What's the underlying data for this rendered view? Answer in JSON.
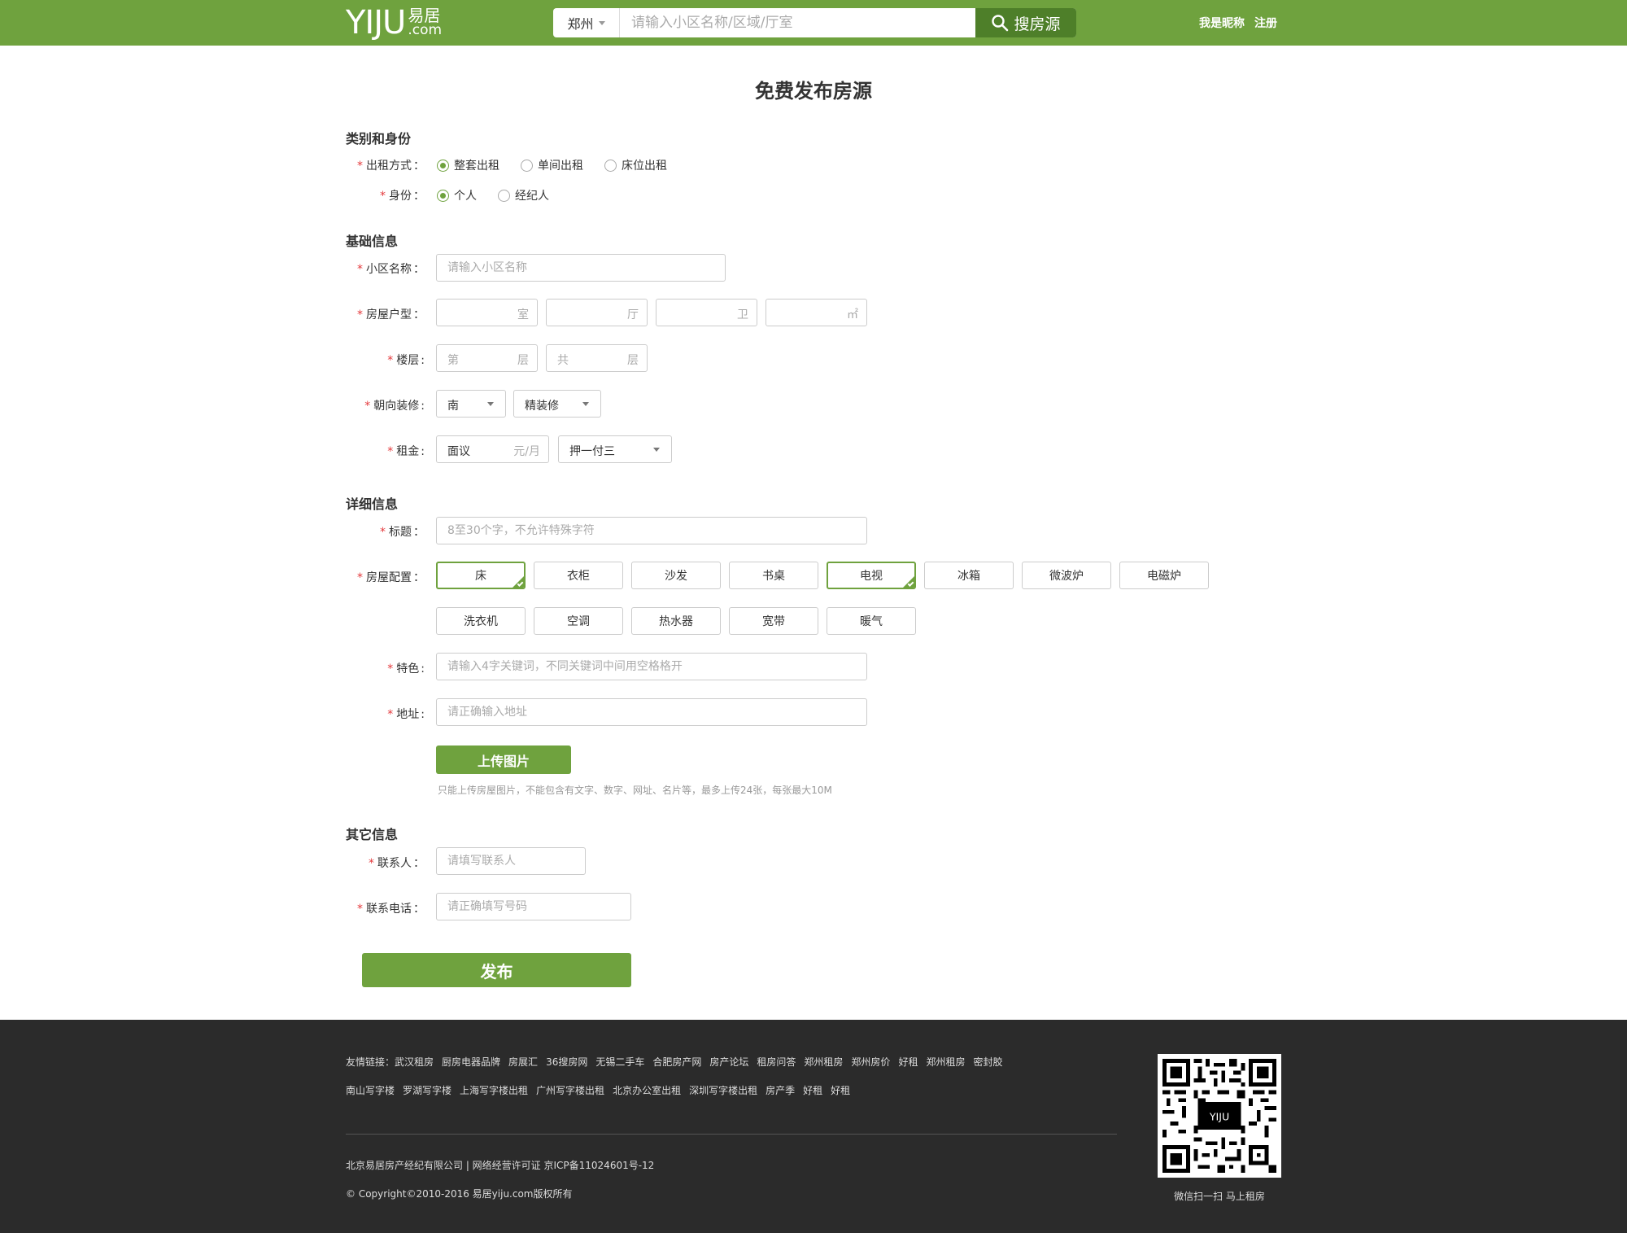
{
  "header": {
    "logo_main": "YIJU",
    "logo_cn": "易居",
    "logo_en": ".com",
    "city": "郑州",
    "search_placeholder": "请输入小区名称/区域/厅室",
    "search_button": "搜房源",
    "nickname": "我是昵称",
    "register": "注册"
  },
  "page_title": "免费发布房源",
  "sections": {
    "category": "类别和身份",
    "basic": "基础信息",
    "detail": "详细信息",
    "other": "其它信息"
  },
  "category": {
    "rent_type_label": "出租方式",
    "rent_types": [
      {
        "label": "整套出租",
        "checked": true
      },
      {
        "label": "单间出租",
        "checked": false
      },
      {
        "label": "床位出租",
        "checked": false
      }
    ],
    "identity_label": "身份",
    "identities": [
      {
        "label": "个人",
        "checked": true
      },
      {
        "label": "经纪人",
        "checked": false
      }
    ]
  },
  "basic": {
    "community_label": "小区名称",
    "community_placeholder": "请输入小区名称",
    "layout_label": "房屋户型",
    "layout_units": [
      "室",
      "厅",
      "卫",
      "㎡"
    ],
    "floor_label": "楼层",
    "floor_prefix": [
      "第",
      "共"
    ],
    "floor_unit": "层",
    "orient_label": "朝向装修",
    "orientation": "南",
    "decoration": "精装修",
    "rent_label": "租金",
    "rent_value": "面议",
    "rent_unit": "元/月",
    "payment": "押一付三"
  },
  "detail": {
    "title_label": "标题",
    "title_placeholder": "8至30个字，不允许特殊字符",
    "config_label": "房屋配置",
    "configs": [
      {
        "label": "床",
        "selected": true
      },
      {
        "label": "衣柜",
        "selected": false
      },
      {
        "label": "沙发",
        "selected": false
      },
      {
        "label": "书桌",
        "selected": false
      },
      {
        "label": "电视",
        "selected": true
      },
      {
        "label": "冰箱",
        "selected": false
      },
      {
        "label": "微波炉",
        "selected": false
      },
      {
        "label": "电磁炉",
        "selected": false
      },
      {
        "label": "洗衣机",
        "selected": false
      },
      {
        "label": "空调",
        "selected": false
      },
      {
        "label": "热水器",
        "selected": false
      },
      {
        "label": "宽带",
        "selected": false
      },
      {
        "label": "暖气",
        "selected": false
      }
    ],
    "feature_label": "特色",
    "feature_placeholder": "请输入4字关键词，不同关键词中间用空格格开",
    "address_label": "地址",
    "address_placeholder": "请正确输入地址",
    "upload_button": "上传图片",
    "upload_hint": "只能上传房屋图片，不能包含有文字、数字、网址、名片等，最多上传24张，每张最大10M"
  },
  "other": {
    "contact_label": "联系人",
    "contact_placeholder": "请填写联系人",
    "phone_label": "联系电话",
    "phone_placeholder": "请正确填写号码"
  },
  "submit_button": "发布",
  "footer": {
    "links_prefix": "友情链接：",
    "links_row1": [
      "武汉租房",
      "厨房电器品牌",
      "房展汇",
      "36搜房网",
      "无锡二手车",
      "合肥房产网",
      "房产论坛",
      "租房问答",
      "郑州租房",
      "郑州房价",
      "好租",
      "郑州租房",
      "密封胶"
    ],
    "links_row2": [
      "南山写字楼",
      "罗湖写字楼",
      "上海写字楼出租",
      "广州写字楼出租",
      "北京办公室出租",
      "深圳写字楼出租",
      "房产季",
      "好租",
      "好租"
    ],
    "company": "北京易居房产经纪有限公司 | 网络经营许可证 京ICP备11024601号-12",
    "copyright": "© Copyright©2010-2016 易居yiju.com版权所有",
    "qr_badge": "YIJU",
    "qr_caption": "微信扫一扫  马上租房"
  },
  "colors": {
    "brand_green": "#6fa23e",
    "search_btn_green": "#4e7f29",
    "footer_bg": "#2b2b2b",
    "required_red": "#e4393c"
  }
}
